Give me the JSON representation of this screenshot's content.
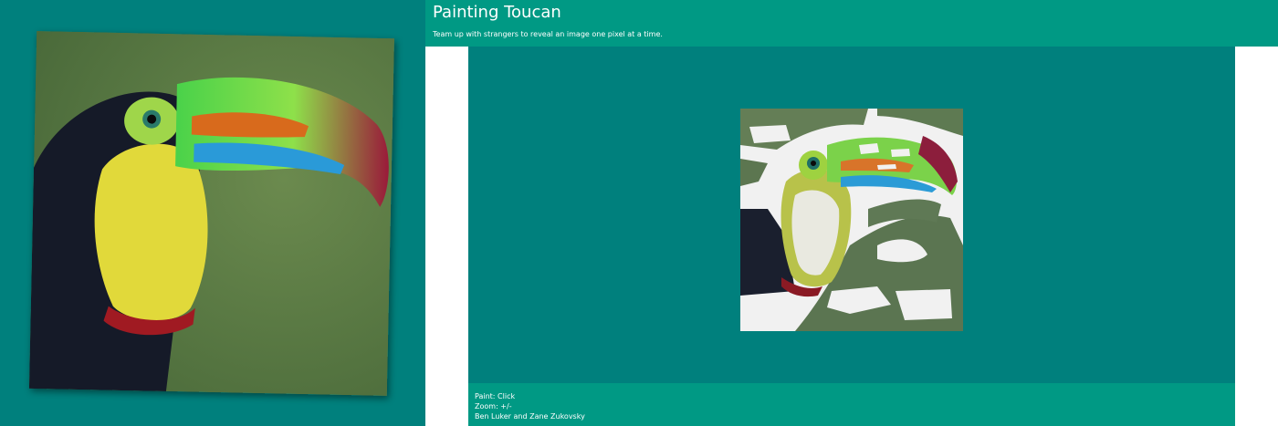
{
  "page": {
    "title": "Painting Toucan",
    "subtitle": "Team up with strangers to reveal an image one pixel at a time."
  },
  "footer": {
    "paint_hint": "Paint: Click",
    "zoom_hint": "Zoom: +/-",
    "credits": "Ben Luker and Zane Zukovsky"
  },
  "colors": {
    "background_teal": "#00807d",
    "header_teal": "#009984",
    "unpainted_white": "#f1f1f1"
  }
}
